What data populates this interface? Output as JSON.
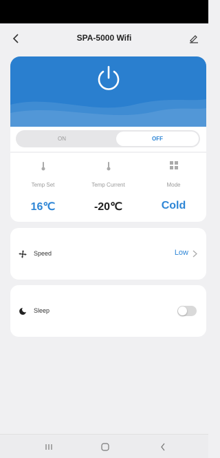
{
  "header": {
    "title": "SPA-5000 Wifi",
    "back_icon": "chevron-left-icon",
    "edit_icon": "edit-pencil-icon"
  },
  "power": {
    "icon": "power-icon",
    "state": "off"
  },
  "toggle": {
    "on_label": "ON",
    "off_label": "OFF",
    "selected": "OFF"
  },
  "stats": [
    {
      "icon": "thermometer-icon",
      "label": "Temp Set",
      "value": "16℃",
      "color": "#2e86d6"
    },
    {
      "icon": "thermometer-icon",
      "label": "Temp Current",
      "value": "-20℃",
      "color": "#222222"
    },
    {
      "icon": "grid-mode-icon",
      "label": "Mode",
      "value": "Cold",
      "color": "#2e86d6"
    }
  ],
  "speed": {
    "icon": "fan-icon",
    "label": "Speed",
    "value": "Low"
  },
  "sleep": {
    "icon": "moon-icon",
    "label": "Sleep",
    "enabled": false
  },
  "colors": {
    "accent": "#2e86d6",
    "hero": "#2a7fcf",
    "background": "#f0f0f2"
  }
}
